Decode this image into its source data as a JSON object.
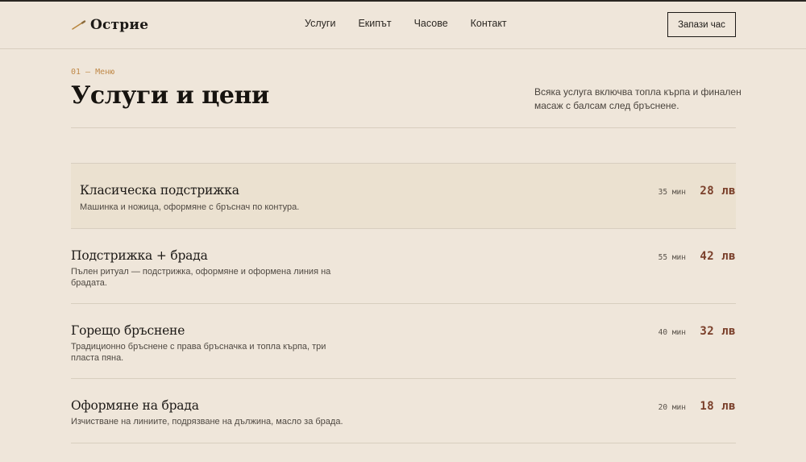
{
  "brand": {
    "name": "Острие",
    "icon": "razor-icon",
    "accent": "#b9873f"
  },
  "nav": {
    "items": [
      "Услуги",
      "Екипът",
      "Часове",
      "Контакт"
    ]
  },
  "cta": {
    "label": "Запази час"
  },
  "section": {
    "eyebrow": "01 — Меню",
    "title": "Услуги и цени",
    "intro": "Всяка услуга включва топла кърпа и финален масаж с балсам след бръснене."
  },
  "services": [
    {
      "name": "Класическа подстрижка",
      "description": "Машинка и ножица, оформяне с бръснач по контура.",
      "duration": "35 мин",
      "price": "28 лв",
      "highlighted": true
    },
    {
      "name": "Подстрижка + брада",
      "description": "Пълен ритуал — подстрижка, оформяне и оформена линия на брадата.",
      "duration": "55 мин",
      "price": "42 лв",
      "highlighted": false
    },
    {
      "name": "Горещо бръснене",
      "description": "Традиционно бръснене с права бръсначка и топла кърпа, три пласта пяна.",
      "duration": "40 мин",
      "price": "32 лв",
      "highlighted": false
    },
    {
      "name": "Оформяне на брада",
      "description": "Изчистване на линиите, подрязване на дължина, масло за брада.",
      "duration": "20 мин",
      "price": "18 лв",
      "highlighted": false
    }
  ],
  "colors": {
    "background": "#efe6da",
    "highlight": "#ebe1d0",
    "price": "#7a3f2a",
    "eyebrow": "#c08a4a"
  }
}
